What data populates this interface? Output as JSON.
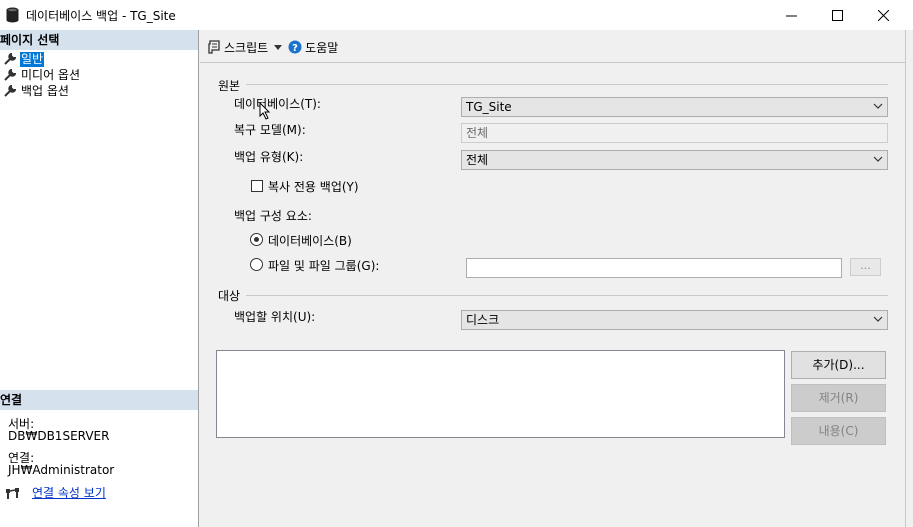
{
  "window": {
    "title": "데이터베이스 백업 - TG_Site",
    "icon": "database-icon",
    "controls": [
      "minimize",
      "maximize",
      "close"
    ]
  },
  "left_panel": {
    "page_select_header": "페이지 선택",
    "pages": [
      {
        "label": "일반",
        "icon": "wrench-icon",
        "selected": true
      },
      {
        "label": "미디어 옵션",
        "icon": "wrench-icon",
        "selected": false
      },
      {
        "label": "백업 옵션",
        "icon": "wrench-icon",
        "selected": false
      }
    ],
    "connection_header": "연결",
    "server_label": "서버:",
    "server_value": "DB₩DB1SERVER",
    "connection_label": "연결:",
    "connection_value": "JH₩Administrator",
    "view_connection_link": "연결 속성 보기"
  },
  "toolbar": {
    "script_label": "스크립트",
    "help_label": "도움말"
  },
  "source": {
    "section_title": "원본",
    "database_label": "데이터베이스(T):",
    "database_value": "TG_Site",
    "recovery_model_label": "복구 모델(M):",
    "recovery_model_value": "전체",
    "backup_type_label": "백업 유형(K):",
    "backup_type_value": "전체",
    "copy_only_label": "복사 전용 백업(Y)",
    "copy_only_checked": false,
    "component_label": "백업 구성 요소:",
    "component_database_label": "데이터베이스(B)",
    "component_files_label": "파일 및 파일 그룹(G):",
    "component_selected": "database",
    "files_value": "",
    "ellipsis_label": "..."
  },
  "destination": {
    "section_title": "대상",
    "backup_to_label": "백업할 위치(U):",
    "backup_to_value": "디스크",
    "add_button": "추가(D)...",
    "remove_button": "제거(R)",
    "contents_button": "내용(C)"
  }
}
